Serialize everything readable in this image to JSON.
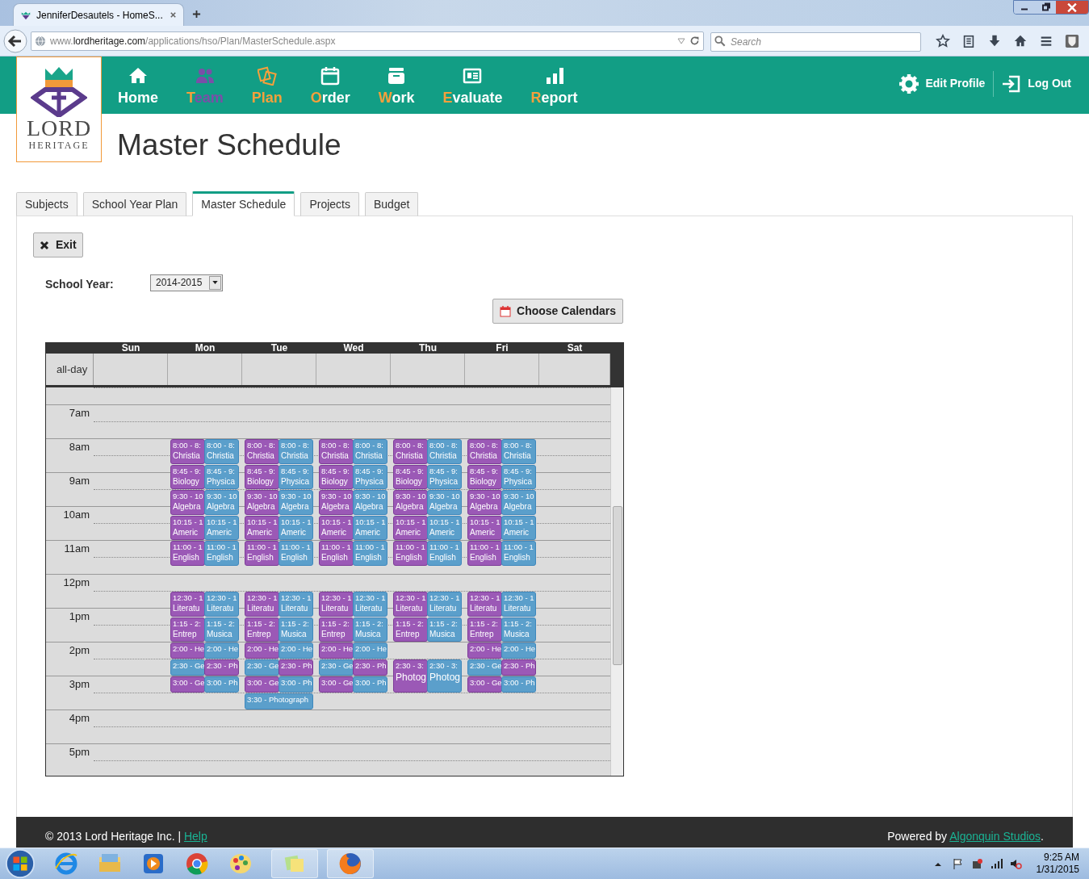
{
  "browser": {
    "tab_title": "JenniferDesautels - HomeS...",
    "url": {
      "prefix": "www.",
      "domain": "lordheritage.com",
      "path": "/applications/hso/Plan/MasterSchedule.aspx"
    },
    "search_placeholder": "Search"
  },
  "logo": {
    "name": "LORD",
    "tagline": "HERITAGE"
  },
  "nav": [
    {
      "label": "Home",
      "selected": false,
      "disabled": false,
      "accent_initial": false
    },
    {
      "label": "Team",
      "selected": false,
      "disabled": true,
      "accent_initial": true
    },
    {
      "label": "Plan",
      "selected": true,
      "disabled": false,
      "accent_initial": true
    },
    {
      "label": "Order",
      "selected": false,
      "disabled": false,
      "accent_initial": true
    },
    {
      "label": "Work",
      "selected": false,
      "disabled": false,
      "accent_initial": true
    },
    {
      "label": "Evaluate",
      "selected": false,
      "disabled": false,
      "accent_initial": true
    },
    {
      "label": "Report",
      "selected": false,
      "disabled": false,
      "accent_initial": true
    }
  ],
  "user_links": [
    {
      "label": "Edit Profile"
    },
    {
      "label": "Log Out"
    }
  ],
  "page_title": "Master Schedule",
  "tabs": [
    {
      "label": "Subjects",
      "selected": false
    },
    {
      "label": "School Year Plan",
      "selected": false
    },
    {
      "label": "Master Schedule",
      "selected": true
    },
    {
      "label": "Projects",
      "selected": false
    },
    {
      "label": "Budget",
      "selected": false
    }
  ],
  "exit_button": "Exit",
  "school_year": {
    "label": "School Year:",
    "value": "2014-2015"
  },
  "choose_calendars_button": "Choose Calendars",
  "calendar": {
    "days": [
      "Sun",
      "Mon",
      "Tue",
      "Wed",
      "Thu",
      "Fri",
      "Sat"
    ],
    "all_day_label": "all-day",
    "hours": [
      "7am",
      "8am",
      "9am",
      "10am",
      "11am",
      "12pm",
      "1pm",
      "2pm",
      "3pm",
      "4pm",
      "5pm"
    ],
    "columns": [
      {
        "events": [
          {
            "time": "8:00 - 8:",
            "title": "Christia",
            "color": "#9b59b6"
          },
          {
            "time": "8:00 - 8:",
            "title": "Christia",
            "color": "#5b9fcb"
          },
          {
            "time": "8:45 - 9:",
            "title": "Biology",
            "color": "#9b59b6"
          },
          {
            "time": "8:45 - 9:",
            "title": "Physica",
            "color": "#5b9fcb"
          },
          {
            "time": "9:30 - 10",
            "title": "Algebra",
            "color": "#9b59b6"
          },
          {
            "time": "9:30 - 10",
            "title": "Algebra",
            "color": "#5b9fcb"
          },
          {
            "time": "10:15 - 1",
            "title": "Americ",
            "color": "#9b59b6"
          },
          {
            "time": "10:15 - 1",
            "title": "Americ",
            "color": "#5b9fcb"
          },
          {
            "time": "11:00 - 1",
            "title": "English",
            "color": "#9b59b6"
          },
          {
            "time": "11:00 - 1",
            "title": "English",
            "color": "#5b9fcb"
          },
          {
            "time": "12:30 - 1",
            "title": "Literatu",
            "color": "#9b59b6"
          },
          {
            "time": "12:30 - 1",
            "title": "Literatu",
            "color": "#5b9fcb"
          },
          {
            "time": "1:15 - 2:",
            "title": "Entrep",
            "color": "#9b59b6"
          },
          {
            "time": "1:15 - 2:",
            "title": "Musica",
            "color": "#5b9fcb"
          },
          {
            "time": "2:00 - He",
            "color": "#9b59b6"
          },
          {
            "time": "2:00 - He",
            "color": "#5b9fcb"
          },
          {
            "time": "2:30 - Ge",
            "color": "#5b9fcb"
          },
          {
            "time": "2:30 - Ph",
            "color": "#9b59b6"
          },
          {
            "time": "3:00 - Ge",
            "color": "#9b59b6"
          },
          {
            "time": "3:00 - Ph",
            "color": "#5b9fcb"
          }
        ]
      },
      {
        "events": [
          {
            "time": "8:00 - 8:",
            "title": "Christia",
            "color": "#9b59b6"
          },
          {
            "time": "8:00 - 8:",
            "title": "Christia",
            "color": "#5b9fcb"
          },
          {
            "time": "8:45 - 9:",
            "title": "Biology",
            "color": "#9b59b6"
          },
          {
            "time": "8:45 - 9:",
            "title": "Physica",
            "color": "#5b9fcb"
          },
          {
            "time": "9:30 - 10",
            "title": "Algebra",
            "color": "#9b59b6"
          },
          {
            "time": "9:30 - 10",
            "title": "Algebra",
            "color": "#5b9fcb"
          },
          {
            "time": "10:15 - 1",
            "title": "Americ",
            "color": "#9b59b6"
          },
          {
            "time": "10:15 - 1",
            "title": "Americ",
            "color": "#5b9fcb"
          },
          {
            "time": "11:00 - 1",
            "title": "English",
            "color": "#9b59b6"
          },
          {
            "time": "11:00 - 1",
            "title": "English",
            "color": "#5b9fcb"
          },
          {
            "time": "12:30 - 1",
            "title": "Literatu",
            "color": "#9b59b6"
          },
          {
            "time": "12:30 - 1",
            "title": "Literatu",
            "color": "#5b9fcb"
          },
          {
            "time": "1:15 - 2:",
            "title": "Entrep",
            "color": "#9b59b6"
          },
          {
            "time": "1:15 - 2:",
            "title": "Musica",
            "color": "#5b9fcb"
          },
          {
            "time": "2:00 - He",
            "color": "#9b59b6"
          },
          {
            "time": "2:00 - He",
            "color": "#5b9fcb"
          },
          {
            "time": "2:30 - Ge",
            "color": "#5b9fcb"
          },
          {
            "time": "2:30 - Ph",
            "color": "#9b59b6"
          },
          {
            "time": "3:00 - Ge",
            "color": "#9b59b6"
          },
          {
            "time": "3:00 - Ph",
            "color": "#5b9fcb"
          },
          {
            "time": "3:30 - Photograph",
            "color": "#5b9fcb"
          }
        ]
      },
      {
        "events": [
          {
            "time": "8:00 - 8:",
            "title": "Christia",
            "color": "#9b59b6"
          },
          {
            "time": "8:00 - 8:",
            "title": "Christia",
            "color": "#5b9fcb"
          },
          {
            "time": "8:45 - 9:",
            "title": "Biology",
            "color": "#9b59b6"
          },
          {
            "time": "8:45 - 9:",
            "title": "Physica",
            "color": "#5b9fcb"
          },
          {
            "time": "9:30 - 10",
            "title": "Algebra",
            "color": "#9b59b6"
          },
          {
            "time": "9:30 - 10",
            "title": "Algebra",
            "color": "#5b9fcb"
          },
          {
            "time": "10:15 - 1",
            "title": "Americ",
            "color": "#9b59b6"
          },
          {
            "time": "10:15 - 1",
            "title": "Americ",
            "color": "#5b9fcb"
          },
          {
            "time": "11:00 - 1",
            "title": "English",
            "color": "#9b59b6"
          },
          {
            "time": "11:00 - 1",
            "title": "English",
            "color": "#5b9fcb"
          },
          {
            "time": "12:30 - 1",
            "title": "Literatu",
            "color": "#9b59b6"
          },
          {
            "time": "12:30 - 1",
            "title": "Literatu",
            "color": "#5b9fcb"
          },
          {
            "time": "1:15 - 2:",
            "title": "Entrep",
            "color": "#9b59b6"
          },
          {
            "time": "1:15 - 2:",
            "title": "Musica",
            "color": "#5b9fcb"
          },
          {
            "time": "2:00 - He",
            "color": "#9b59b6"
          },
          {
            "time": "2:00 - He",
            "color": "#5b9fcb"
          },
          {
            "time": "2:30 - Ge",
            "color": "#5b9fcb"
          },
          {
            "time": "2:30 - Ph",
            "color": "#9b59b6"
          },
          {
            "time": "3:00 - Ge",
            "color": "#9b59b6"
          },
          {
            "time": "3:00 - Ph",
            "color": "#5b9fcb"
          }
        ]
      },
      {
        "events": [
          {
            "time": "8:00 - 8:",
            "title": "Christia",
            "color": "#9b59b6"
          },
          {
            "time": "8:00 - 8:",
            "title": "Christia",
            "color": "#5b9fcb"
          },
          {
            "time": "8:45 - 9:",
            "title": "Biology",
            "color": "#9b59b6"
          },
          {
            "time": "8:45 - 9:",
            "title": "Physica",
            "color": "#5b9fcb"
          },
          {
            "time": "9:30 - 10",
            "title": "Algebra",
            "color": "#9b59b6"
          },
          {
            "time": "9:30 - 10",
            "title": "Algebra",
            "color": "#5b9fcb"
          },
          {
            "time": "10:15 - 1",
            "title": "Americ",
            "color": "#9b59b6"
          },
          {
            "time": "10:15 - 1",
            "title": "Americ",
            "color": "#5b9fcb"
          },
          {
            "time": "11:00 - 1",
            "title": "English",
            "color": "#9b59b6"
          },
          {
            "time": "11:00 - 1",
            "title": "English",
            "color": "#5b9fcb"
          },
          {
            "time": "12:30 - 1",
            "title": "Literatu",
            "color": "#9b59b6"
          },
          {
            "time": "12:30 - 1",
            "title": "Literatu",
            "color": "#5b9fcb"
          },
          {
            "time": "1:15 - 2:",
            "title": "Entrep",
            "color": "#9b59b6"
          },
          {
            "time": "1:15 - 2:",
            "title": "Musica",
            "color": "#5b9fcb"
          },
          {
            "time": "2:30 - 3:",
            "title": "Photog",
            "color": "#9b59b6"
          },
          {
            "time": "2:30 - 3:",
            "title": "Photog",
            "color": "#5b9fcb"
          }
        ]
      },
      {
        "events": [
          {
            "time": "8:00 - 8:",
            "title": "Christia",
            "color": "#9b59b6"
          },
          {
            "time": "8:00 - 8:",
            "title": "Christia",
            "color": "#5b9fcb"
          },
          {
            "time": "8:45 - 9:",
            "title": "Biology",
            "color": "#9b59b6"
          },
          {
            "time": "8:45 - 9:",
            "title": "Physica",
            "color": "#5b9fcb"
          },
          {
            "time": "9:30 - 10",
            "title": "Algebra",
            "color": "#9b59b6"
          },
          {
            "time": "9:30 - 10",
            "title": "Algebra",
            "color": "#5b9fcb"
          },
          {
            "time": "10:15 - 1",
            "title": "Americ",
            "color": "#9b59b6"
          },
          {
            "time": "10:15 - 1",
            "title": "Americ",
            "color": "#5b9fcb"
          },
          {
            "time": "11:00 - 1",
            "title": "English",
            "color": "#9b59b6"
          },
          {
            "time": "11:00 - 1",
            "title": "English",
            "color": "#5b9fcb"
          },
          {
            "time": "12:30 - 1",
            "title": "Literatu",
            "color": "#9b59b6"
          },
          {
            "time": "12:30 - 1",
            "title": "Literatu",
            "color": "#5b9fcb"
          },
          {
            "time": "1:15 - 2:",
            "title": "Entrep",
            "color": "#9b59b6"
          },
          {
            "time": "1:15 - 2:",
            "title": "Musica",
            "color": "#5b9fcb"
          },
          {
            "time": "2:00 - He",
            "color": "#9b59b6"
          },
          {
            "time": "2:00 - He",
            "color": "#5b9fcb"
          },
          {
            "time": "2:30 - Ge",
            "color": "#5b9fcb"
          },
          {
            "time": "2:30 - Ph",
            "color": "#9b59b6"
          },
          {
            "time": "3:00 - Ge",
            "color": "#9b59b6"
          },
          {
            "time": "3:00 - Ph",
            "color": "#5b9fcb"
          }
        ]
      }
    ]
  },
  "footer": {
    "copyright": "© 2013 Lord Heritage Inc. |",
    "help_link": "Help",
    "powered_by": "Powered by",
    "studio_link": "Algonquin Studios",
    "end": "."
  },
  "taskbar": {
    "time": "9:25 AM",
    "date": "1/31/2015"
  }
}
